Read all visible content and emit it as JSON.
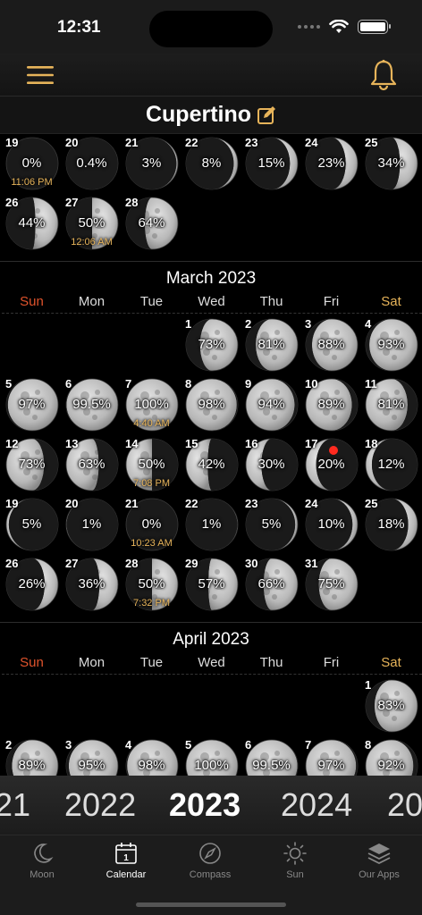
{
  "status": {
    "time": "12:31"
  },
  "location": {
    "title": "Cupertino"
  },
  "months": [
    {
      "title": "",
      "show_header": false,
      "offset": 0,
      "days": [
        {
          "num": "19",
          "pct": "0%",
          "frac": 0,
          "wax": true,
          "time": "11:06 PM"
        },
        {
          "num": "20",
          "pct": "0.4%",
          "frac": 0.004,
          "wax": true
        },
        {
          "num": "21",
          "pct": "3%",
          "frac": 0.03,
          "wax": true
        },
        {
          "num": "22",
          "pct": "8%",
          "frac": 0.08,
          "wax": true
        },
        {
          "num": "23",
          "pct": "15%",
          "frac": 0.15,
          "wax": true
        },
        {
          "num": "24",
          "pct": "23%",
          "frac": 0.23,
          "wax": true
        },
        {
          "num": "25",
          "pct": "34%",
          "frac": 0.34,
          "wax": true
        },
        {
          "num": "26",
          "pct": "44%",
          "frac": 0.44,
          "wax": true
        },
        {
          "num": "27",
          "pct": "50%",
          "frac": 0.5,
          "wax": true,
          "time": "12:06 AM"
        },
        {
          "num": "28",
          "pct": "64%",
          "frac": 0.64,
          "wax": true
        }
      ]
    },
    {
      "title": "March 2023",
      "show_header": true,
      "offset": 3,
      "days": [
        {
          "num": "1",
          "pct": "73%",
          "frac": 0.73,
          "wax": true
        },
        {
          "num": "2",
          "pct": "81%",
          "frac": 0.81,
          "wax": true
        },
        {
          "num": "3",
          "pct": "88%",
          "frac": 0.88,
          "wax": true
        },
        {
          "num": "4",
          "pct": "93%",
          "frac": 0.93,
          "wax": true
        },
        {
          "num": "5",
          "pct": "97%",
          "frac": 0.97,
          "wax": true
        },
        {
          "num": "6",
          "pct": "99.5%",
          "frac": 0.995,
          "wax": true
        },
        {
          "num": "7",
          "pct": "100%",
          "frac": 1,
          "wax": true,
          "time": "4:40 AM"
        },
        {
          "num": "8",
          "pct": "98%",
          "frac": 0.98,
          "wax": false
        },
        {
          "num": "9",
          "pct": "94%",
          "frac": 0.94,
          "wax": false
        },
        {
          "num": "10",
          "pct": "89%",
          "frac": 0.89,
          "wax": false
        },
        {
          "num": "11",
          "pct": "81%",
          "frac": 0.81,
          "wax": false
        },
        {
          "num": "12",
          "pct": "73%",
          "frac": 0.73,
          "wax": false
        },
        {
          "num": "13",
          "pct": "63%",
          "frac": 0.63,
          "wax": false
        },
        {
          "num": "14",
          "pct": "50%",
          "frac": 0.5,
          "wax": false,
          "time": "7:08 PM"
        },
        {
          "num": "15",
          "pct": "42%",
          "frac": 0.42,
          "wax": false
        },
        {
          "num": "16",
          "pct": "30%",
          "frac": 0.3,
          "wax": false
        },
        {
          "num": "17",
          "pct": "20%",
          "frac": 0.2,
          "wax": false,
          "today": true
        },
        {
          "num": "18",
          "pct": "12%",
          "frac": 0.12,
          "wax": false
        },
        {
          "num": "19",
          "pct": "5%",
          "frac": 0.05,
          "wax": false
        },
        {
          "num": "20",
          "pct": "1%",
          "frac": 0.01,
          "wax": false
        },
        {
          "num": "21",
          "pct": "0%",
          "frac": 0,
          "wax": true,
          "time": "10:23 AM"
        },
        {
          "num": "22",
          "pct": "1%",
          "frac": 0.01,
          "wax": true
        },
        {
          "num": "23",
          "pct": "5%",
          "frac": 0.05,
          "wax": true
        },
        {
          "num": "24",
          "pct": "10%",
          "frac": 0.1,
          "wax": true
        },
        {
          "num": "25",
          "pct": "18%",
          "frac": 0.18,
          "wax": true
        },
        {
          "num": "26",
          "pct": "26%",
          "frac": 0.26,
          "wax": true
        },
        {
          "num": "27",
          "pct": "36%",
          "frac": 0.36,
          "wax": true
        },
        {
          "num": "28",
          "pct": "50%",
          "frac": 0.5,
          "wax": true,
          "time": "7:32 PM"
        },
        {
          "num": "29",
          "pct": "57%",
          "frac": 0.57,
          "wax": true
        },
        {
          "num": "30",
          "pct": "66%",
          "frac": 0.66,
          "wax": true
        },
        {
          "num": "31",
          "pct": "75%",
          "frac": 0.75,
          "wax": true
        }
      ]
    },
    {
      "title": "April 2023",
      "show_header": true,
      "offset": 6,
      "days": [
        {
          "num": "1",
          "pct": "83%",
          "frac": 0.83,
          "wax": true
        },
        {
          "num": "2",
          "pct": "89%",
          "frac": 0.89,
          "wax": true
        },
        {
          "num": "3",
          "pct": "95%",
          "frac": 0.95,
          "wax": true
        },
        {
          "num": "4",
          "pct": "98%",
          "frac": 0.98,
          "wax": true
        },
        {
          "num": "5",
          "pct": "100%",
          "frac": 1,
          "wax": true
        },
        {
          "num": "6",
          "pct": "99.5%",
          "frac": 0.995,
          "wax": false
        },
        {
          "num": "7",
          "pct": "97%",
          "frac": 0.97,
          "wax": false
        },
        {
          "num": "8",
          "pct": "92%",
          "frac": 0.92,
          "wax": false
        }
      ]
    }
  ],
  "weekdays": [
    "Sun",
    "Mon",
    "Tue",
    "Wed",
    "Thu",
    "Fri",
    "Sat"
  ],
  "years": [
    "21",
    "2022",
    "2023",
    "2024",
    "20"
  ],
  "selected_year": "2023",
  "tabs": [
    {
      "label": "Moon",
      "icon": "moon-icon"
    },
    {
      "label": "Calendar",
      "icon": "calendar-icon",
      "badge": "1"
    },
    {
      "label": "Compass",
      "icon": "compass-icon"
    },
    {
      "label": "Sun",
      "icon": "sun-icon"
    },
    {
      "label": "Our Apps",
      "icon": "layers-icon"
    }
  ],
  "active_tab": "Calendar",
  "colors": {
    "accent": "#e7b45a",
    "sunday": "#e0532c",
    "saturday": "#e7b45a",
    "today_dot": "#ff2a1f"
  }
}
